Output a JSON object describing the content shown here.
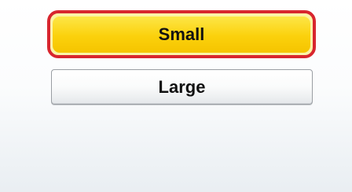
{
  "options": [
    {
      "label": "Small",
      "selected": true
    },
    {
      "label": "Large",
      "selected": false
    }
  ],
  "colors": {
    "selected_fill": "#fbd10c",
    "selected_border": "#d8262e",
    "button_fill": "#f4f5f6",
    "button_border": "#9a9ea3",
    "text": "#111111",
    "background": "#f2f5f8"
  }
}
